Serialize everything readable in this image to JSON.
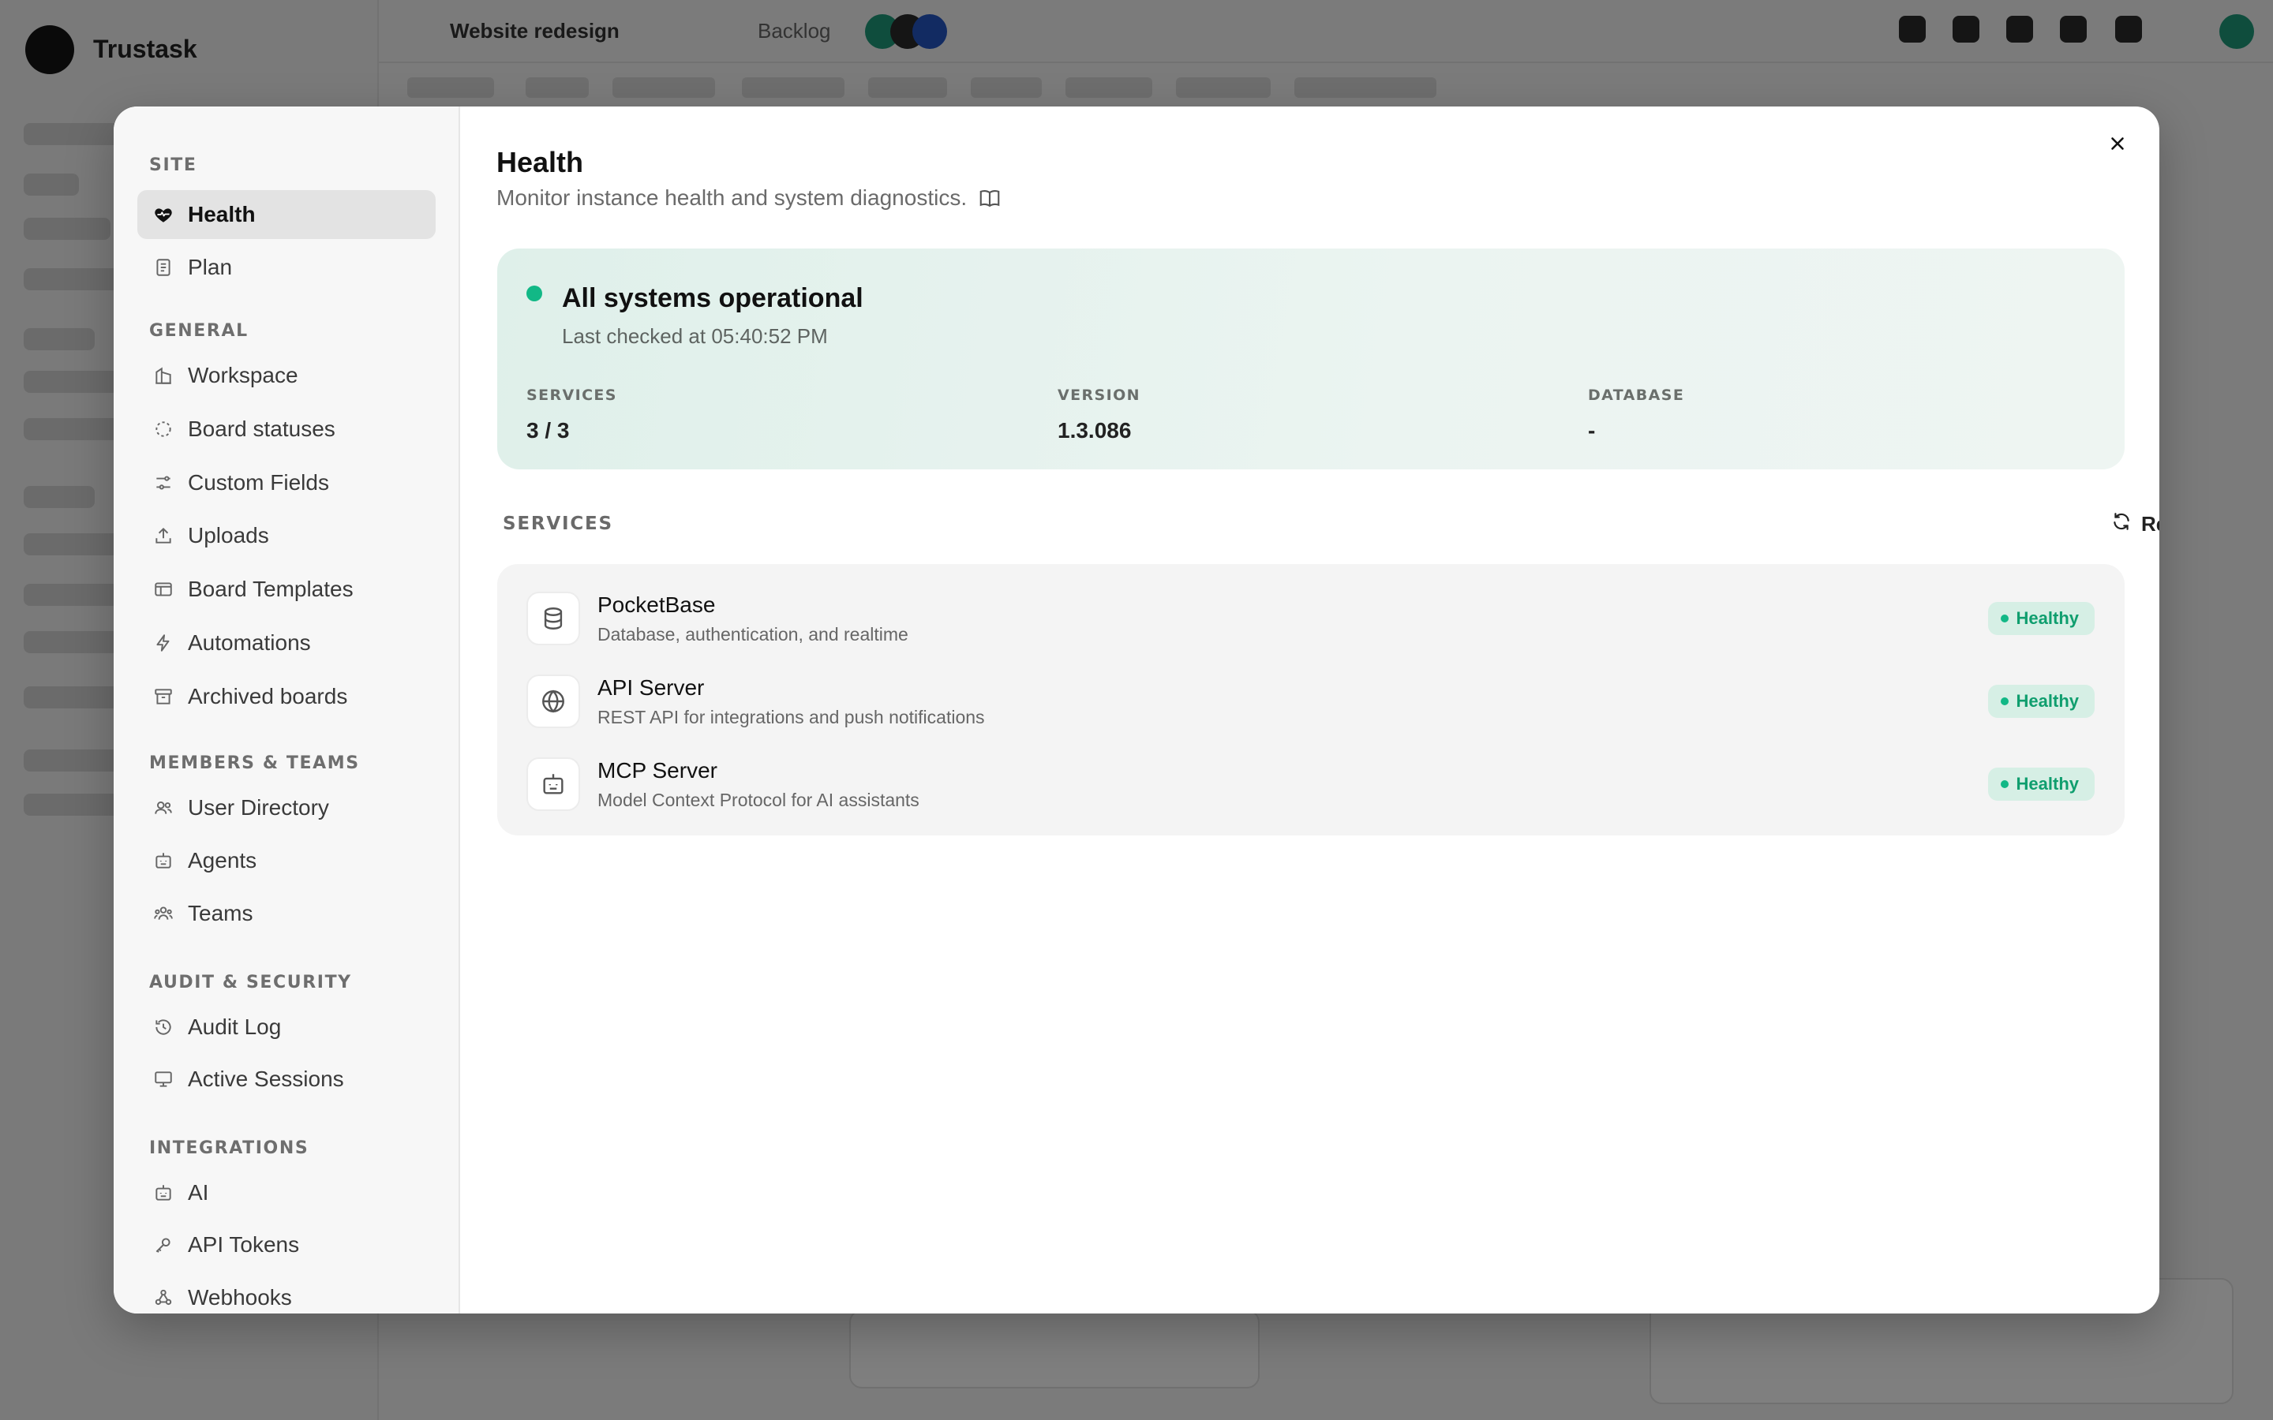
{
  "background": {
    "brand": "Trustask",
    "board_title": "Website redesign",
    "board_subtitle": "Backlog"
  },
  "nav": {
    "sections": [
      {
        "label": "SITE",
        "items": [
          {
            "label": "Health",
            "icon": "heart-icon",
            "active": true
          },
          {
            "label": "Plan",
            "icon": "receipt-icon"
          }
        ]
      },
      {
        "label": "GENERAL",
        "items": [
          {
            "label": "Workspace",
            "icon": "building-icon"
          },
          {
            "label": "Board statuses",
            "icon": "dashed-circle-icon"
          },
          {
            "label": "Custom Fields",
            "icon": "sliders-icon"
          },
          {
            "label": "Uploads",
            "icon": "upload-icon"
          },
          {
            "label": "Board Templates",
            "icon": "template-icon"
          },
          {
            "label": "Automations",
            "icon": "lightning-icon"
          },
          {
            "label": "Archived boards",
            "icon": "archive-icon"
          }
        ]
      },
      {
        "label": "MEMBERS & TEAMS",
        "items": [
          {
            "label": "User Directory",
            "icon": "users-icon"
          },
          {
            "label": "Agents",
            "icon": "robot-icon"
          },
          {
            "label": "Teams",
            "icon": "team-icon"
          }
        ]
      },
      {
        "label": "AUDIT & SECURITY",
        "items": [
          {
            "label": "Audit Log",
            "icon": "history-icon"
          },
          {
            "label": "Active Sessions",
            "icon": "monitor-icon"
          }
        ]
      },
      {
        "label": "INTEGRATIONS",
        "items": [
          {
            "label": "AI",
            "icon": "robot-icon"
          },
          {
            "label": "API Tokens",
            "icon": "key-icon"
          },
          {
            "label": "Webhooks",
            "icon": "webhook-icon"
          }
        ]
      }
    ]
  },
  "page": {
    "title": "Health",
    "description": "Monitor instance health and system diagnostics.",
    "close_label": "Close"
  },
  "status": {
    "title": "All systems operational",
    "last_checked": "Last checked at 05:40:52 PM",
    "color": "#12b886",
    "stats": [
      {
        "label": "SERVICES",
        "value": "3 / 3"
      },
      {
        "label": "VERSION",
        "value": "1.3.086"
      },
      {
        "label": "DATABASE",
        "value": "-"
      }
    ]
  },
  "services": {
    "label": "SERVICES",
    "refresh_label": "Refresh",
    "items": [
      {
        "name": "PocketBase",
        "description": "Database, authentication, and realtime",
        "status": "Healthy",
        "icon": "database-icon"
      },
      {
        "name": "API Server",
        "description": "REST API for integrations and push notifications",
        "status": "Healthy",
        "icon": "globe-icon"
      },
      {
        "name": "MCP Server",
        "description": "Model Context Protocol for AI assistants",
        "status": "Healthy",
        "icon": "robot-icon"
      }
    ]
  }
}
